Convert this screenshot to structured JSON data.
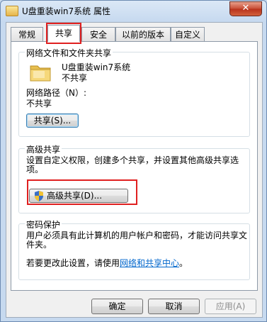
{
  "window": {
    "title": "U盘重装win7系统 属性",
    "close_label": "✕"
  },
  "tabs": [
    {
      "label": "常规"
    },
    {
      "label": "共享"
    },
    {
      "label": "安全"
    },
    {
      "label": "以前的版本"
    },
    {
      "label": "自定义"
    }
  ],
  "network_sharing": {
    "heading": "网络文件和文件夹共享",
    "folder_name": "U盘重装win7系统",
    "folder_status": "不共享",
    "path_label": "网络路径（N）:",
    "path_value": "不共享",
    "share_button": "共享(S)..."
  },
  "advanced_sharing": {
    "heading": "高级共享",
    "description": "设置自定义权限，创建多个共享，并设置其他高级共享选项。",
    "button": "高级共享(D)..."
  },
  "password_protection": {
    "heading": "密码保护",
    "description": "用户必须具有此计算机的用户帐户和密码，才能访问共享文件夹。",
    "change_prefix": "若要更改此设置，请使用",
    "link_text": "网络和共享中心",
    "change_suffix": "。"
  },
  "footer": {
    "ok": "确定",
    "cancel": "取消",
    "apply": "应用(A)"
  }
}
